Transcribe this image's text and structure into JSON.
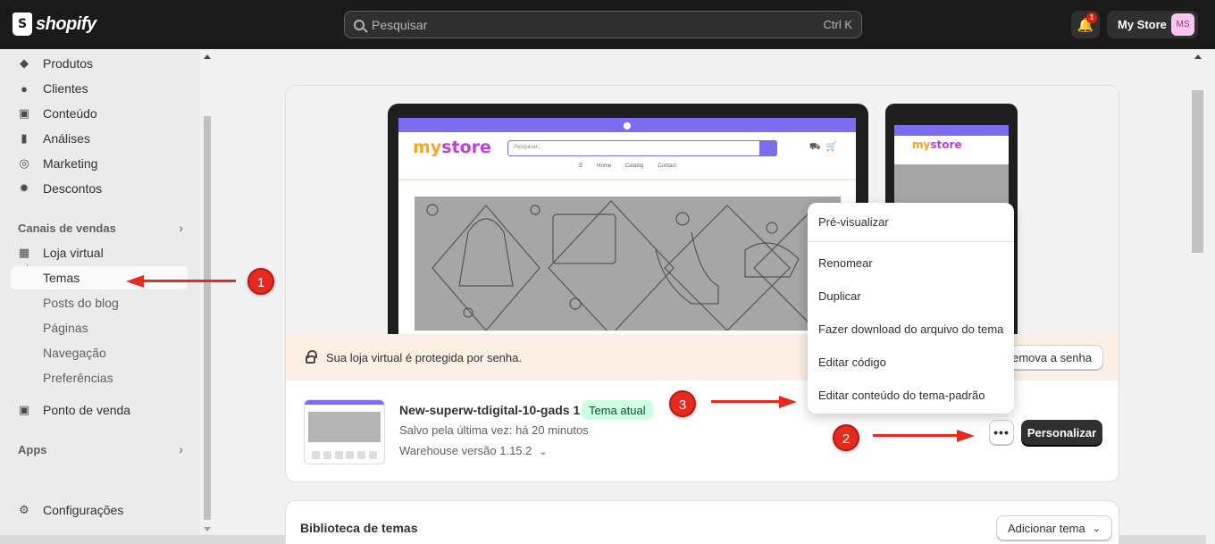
{
  "topbar": {
    "logo_text": "shopify",
    "search_placeholder": "Pesquisar",
    "search_shortcut": "Ctrl K",
    "notification_count": "1",
    "store_name": "My Store",
    "avatar_initials": "MS"
  },
  "sidebar": {
    "items": [
      {
        "label": "Produtos",
        "icon": "tag-icon"
      },
      {
        "label": "Clientes",
        "icon": "person-icon"
      },
      {
        "label": "Conteúdo",
        "icon": "image-icon"
      },
      {
        "label": "Análises",
        "icon": "bar-chart-icon"
      },
      {
        "label": "Marketing",
        "icon": "target-icon"
      },
      {
        "label": "Descontos",
        "icon": "discount-icon"
      }
    ],
    "sales_channels_title": "Canais de vendas",
    "online_store": "Loja virtual",
    "sub_items": [
      "Temas",
      "Posts do blog",
      "Páginas",
      "Navegação",
      "Preferências"
    ],
    "pos": "Ponto de venda",
    "apps_title": "Apps",
    "settings": "Configurações"
  },
  "preview": {
    "laptop_logo_a": "my",
    "laptop_logo_b": "store",
    "laptop_search_placeholder": "Pesquisar...",
    "laptop_nav": "☰ Home Catalog Contact",
    "phone_logo_a": "my",
    "phone_logo_b": "store"
  },
  "banner": {
    "text": "Sua loja virtual é protegida por senha.",
    "button": "Remova a senha"
  },
  "theme": {
    "name": "New-superw-tdigital-10-gads 1",
    "badge": "Tema atual",
    "saved": "Salvo pela última vez: há 20 minutos",
    "version": "Warehouse versão 1.15.2",
    "more_button": "•••",
    "customize_button": "Personalizar"
  },
  "menu": {
    "items": [
      "Pré-visualizar",
      "Renomear",
      "Duplicar",
      "Fazer download do arquivo do tema",
      "Editar código",
      "Editar conteúdo do tema-padrão"
    ]
  },
  "library": {
    "title": "Biblioteca de temas",
    "add_button": "Adicionar tema"
  },
  "annotations": [
    "1",
    "2",
    "3"
  ],
  "colors": {
    "accent_purple": "#7c6cf0",
    "annotation_red": "#e52a20",
    "badge_green": "#cdfee1"
  }
}
